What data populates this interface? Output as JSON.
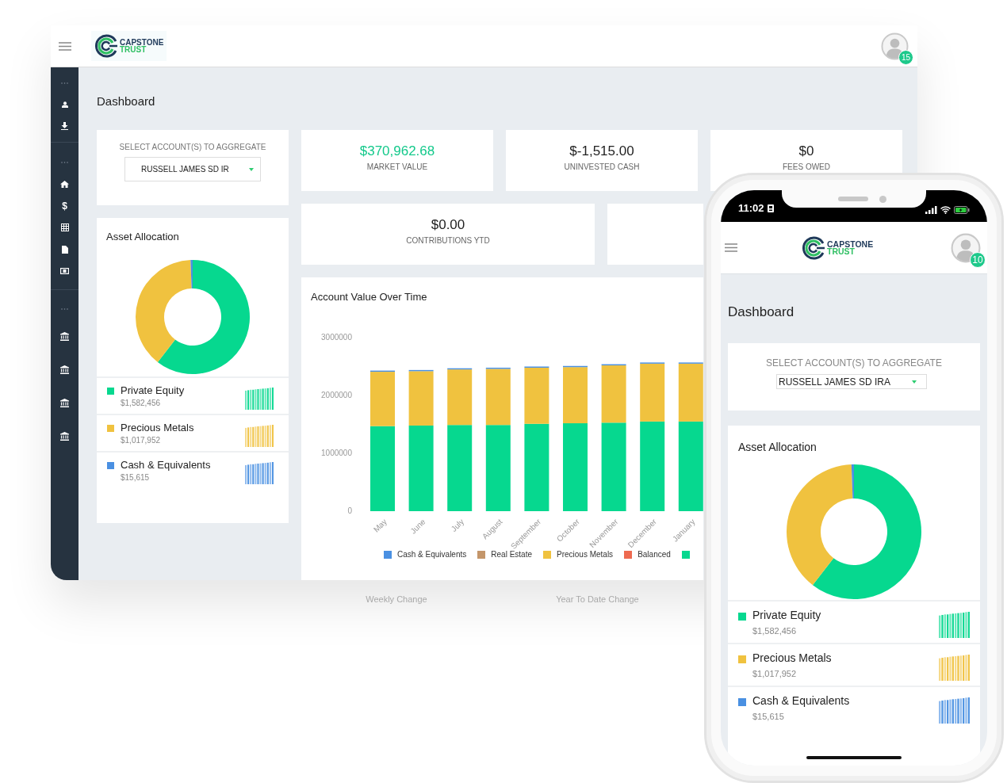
{
  "desktop": {
    "header": {
      "logo": {
        "title": "CAPSTONE",
        "subtitle": "TRUST"
      },
      "notification_count": "15"
    },
    "sidebar": {
      "groups": [
        [
          {
            "kind": "more"
          },
          {
            "kind": "user"
          },
          {
            "kind": "download"
          }
        ],
        [
          {
            "kind": "more"
          },
          {
            "kind": "home"
          },
          {
            "kind": "glyph",
            "glyph": "$"
          },
          {
            "kind": "grid"
          },
          {
            "kind": "document"
          },
          {
            "kind": "money"
          }
        ],
        [
          {
            "kind": "more"
          },
          {
            "kind": "bank"
          },
          {
            "kind": "bank"
          },
          {
            "kind": "bank"
          },
          {
            "kind": "bank"
          }
        ]
      ]
    },
    "page_title": "Dashboard",
    "account_select": {
      "label": "SELECT ACCOUNT(S) TO AGGREGATE",
      "value": "RUSSELL JAMES SD IR"
    },
    "stats": [
      {
        "value": "$370,962.68",
        "label": "MARKET VALUE",
        "highlighted": true
      },
      {
        "value": "$-1,515.00",
        "label": "UNINVESTED CASH",
        "highlighted": false
      },
      {
        "value": "$0",
        "label": "FEES OWED",
        "highlighted": false
      }
    ],
    "stats_row_2": [
      {
        "value": "$0.00",
        "label": "CONTRIBUTIONS YTD",
        "highlighted": false
      }
    ],
    "asset_allocation": {
      "title": "Asset Allocation",
      "chart_data": {
        "type": "donut",
        "categories": [
          "Private Equity",
          "Precious Metals",
          "Cash & Equivalents"
        ],
        "values": [
          60.5,
          38.9,
          0.6
        ]
      },
      "items": [
        {
          "amount": "$1,582,456",
          "color": "#06d88f"
        },
        {
          "amount": "$1,017,952",
          "color": "#f0c23f"
        },
        {
          "amount": "$15,615",
          "color": "#4a90e2"
        }
      ]
    },
    "value_chart": {
      "title": "Account Value Over Time",
      "chart_data": {
        "type": "bar",
        "stacked": true,
        "categories": [
          "May",
          "June",
          "July",
          "August",
          "September",
          "October",
          "November",
          "December",
          "January"
        ],
        "ylim": [
          0,
          3000000
        ],
        "yticks": [
          0,
          1000000,
          2000000,
          3000000
        ],
        "series": [
          {
            "name": "Cash & Equivalents",
            "color": "#4a90e2",
            "values": [
              20000,
              20000,
              20000,
              20000,
              20000,
              20000,
              20000,
              20000,
              20000
            ]
          },
          {
            "name": "Real Estate",
            "color": "#c4966a",
            "values": [
              0,
              0,
              0,
              0,
              0,
              0,
              0,
              0,
              0
            ]
          },
          {
            "name": "Precious Metals",
            "color": "#f0c23f",
            "values": [
              940000,
              940000,
              960000,
              970000,
              970000,
              970000,
              990000,
              1000000,
              1000000
            ]
          },
          {
            "name": "Balanced",
            "color": "#ee6a50",
            "values": [
              0,
              0,
              0,
              0,
              0,
              0,
              0,
              0,
              0
            ]
          },
          {
            "color": "#06d88f",
            "values": [
              1470000,
              1480000,
              1490000,
              1490000,
              1510000,
              1520000,
              1530000,
              1550000,
              1550000
            ]
          }
        ]
      }
    },
    "reflection": [
      "Weekly Change",
      "Year To Date Change"
    ]
  },
  "phone": {
    "status_bar": {
      "time": "11:02"
    },
    "header": {
      "logo": {
        "title": "CAPSTONE",
        "subtitle": "TRUST"
      },
      "notification_count": "10"
    },
    "page_title": "Dashboard",
    "account_select": {
      "label": "SELECT ACCOUNT(S) TO AGGREGATE",
      "value": "RUSSELL JAMES SD IRA"
    },
    "asset_allocation": {
      "title": "Asset Allocation",
      "chart_data": {
        "type": "donut",
        "categories": [
          "Private Equity",
          "Precious Metals",
          "Cash & Equivalents"
        ],
        "values": [
          60.5,
          38.9,
          0.6
        ]
      },
      "items": [
        {
          "amount": "$1,582,456",
          "color": "#06d88f"
        },
        {
          "amount": "$1,017,952",
          "color": "#f0c23f"
        },
        {
          "amount": "$15,615",
          "color": "#4a90e2"
        }
      ]
    }
  }
}
